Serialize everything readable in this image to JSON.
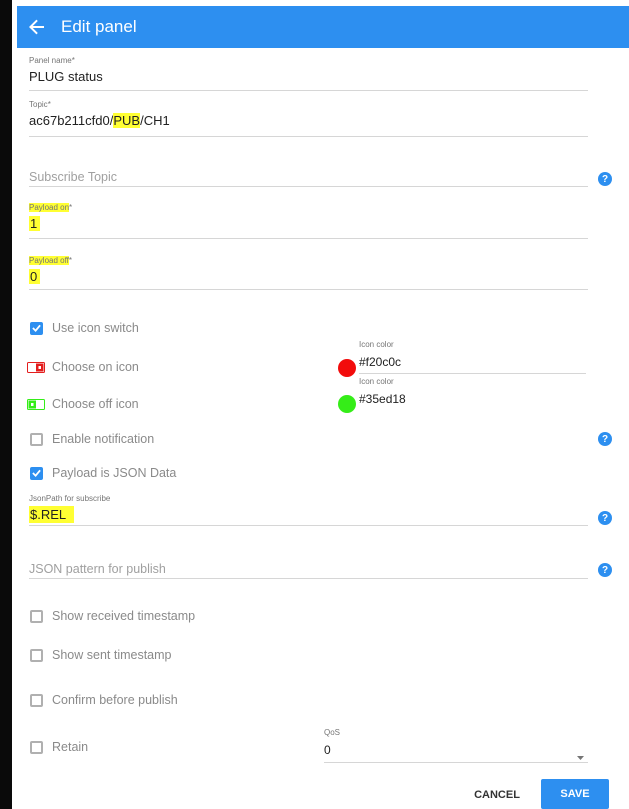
{
  "header": {
    "title": "Edit panel",
    "back_icon": "arrow-left-icon"
  },
  "form": {
    "panel_name": {
      "label": "Panel name",
      "required": "*",
      "value": "PLUG status"
    },
    "topic": {
      "label": "Topic",
      "required": "*",
      "value_prefix": "ac67b211cfd0/",
      "value_highlight": "PUB",
      "value_suffix": "/CH1"
    },
    "subscribe_topic": {
      "placeholder": "Subscribe Topic"
    },
    "payload_on": {
      "label": "Payload on",
      "required": "*",
      "value": "1"
    },
    "payload_off": {
      "label": "Payload off",
      "required": "*",
      "value": "0"
    },
    "use_icon_switch": {
      "label": "Use icon switch",
      "checked": true
    },
    "on_icon": {
      "label": "Choose on icon",
      "color_label": "Icon color",
      "color_value": "#f20c0c"
    },
    "off_icon": {
      "label": "Choose off icon",
      "color_label": "Icon color",
      "color_value": "#35ed18"
    },
    "enable_notification": {
      "label": "Enable notification",
      "checked": false
    },
    "payload_is_json": {
      "label": "Payload is JSON Data",
      "checked": true
    },
    "jsonpath": {
      "label": "JsonPath for subscribe",
      "value": "$.REL"
    },
    "json_pattern": {
      "placeholder": "JSON pattern for publish"
    },
    "show_received_timestamp": {
      "label": "Show received timestamp",
      "checked": false
    },
    "show_sent_timestamp": {
      "label": "Show sent timestamp",
      "checked": false
    },
    "confirm_before_publish": {
      "label": "Confirm before publish",
      "checked": false
    },
    "retain": {
      "label": "Retain",
      "checked": false
    },
    "qos": {
      "label": "QoS",
      "value": "0"
    }
  },
  "actions": {
    "cancel": "CANCEL",
    "save": "SAVE"
  },
  "colors": {
    "accent": "#2d8ff0",
    "highlight": "#ffff33",
    "on_color": "#f20c0c",
    "off_color": "#35ed18"
  }
}
